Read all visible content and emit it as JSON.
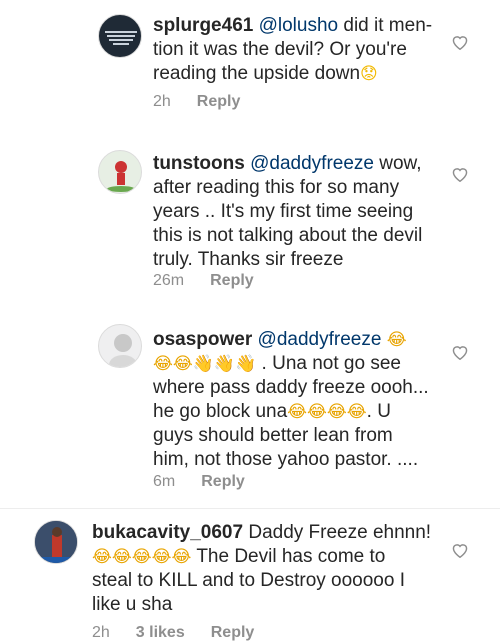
{
  "comments": [
    {
      "username": "splurge461",
      "mention": "@lolusho",
      "text_parts": [
        "did it men-",
        "tion it was the devil? Or you're",
        "reading the upside down"
      ],
      "trailing_emoji": "worried-face",
      "time": "2h",
      "reply_label": "Reply"
    },
    {
      "username": "tunstoons",
      "mention": "@daddyfreeze",
      "text_parts": [
        "wow,",
        "after reading this for so many",
        "years .. It's my first time seeing",
        "this is not talking about the devil",
        "truly.  Thanks sir freeze"
      ],
      "time": "26m",
      "reply_label": "Reply"
    },
    {
      "username": "osaspower",
      "mention": "@daddyfreeze",
      "text_parts": [
        ". Una not go see",
        "where pass daddy freeze oooh...",
        "he go block una",
        ". U",
        "guys should better lean from",
        "him, not those yahoo pastor. ...."
      ],
      "time": "6m",
      "reply_label": "Reply"
    },
    {
      "username": "bukacavity_0607",
      "text_parts": [
        "Daddy Freeze ehnnn!",
        "The Devil has come to",
        "steal to KILL and to Destroy oooooo I",
        "like u sha"
      ],
      "time": "2h",
      "likes": "3 likes",
      "reply_label": "Reply"
    }
  ],
  "colors": {
    "text": "#262626",
    "mention": "#00376b",
    "meta": "#8e8e8e"
  }
}
